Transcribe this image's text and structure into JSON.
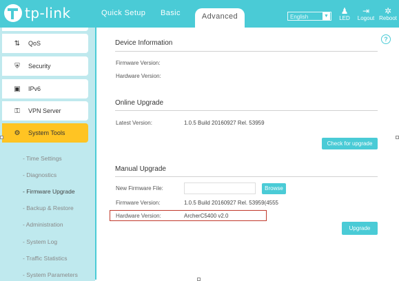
{
  "header": {
    "logo_text": "tp-link",
    "tabs": [
      {
        "label": "Quick Setup"
      },
      {
        "label": "Basic"
      },
      {
        "label": "Advanced"
      }
    ],
    "language": "English",
    "buttons": {
      "led": "LED",
      "logout": "Logout",
      "reboot": "Reboot"
    }
  },
  "sidebar": {
    "items": [
      {
        "label": "QoS",
        "icon": "arrows-updown-icon"
      },
      {
        "label": "Security",
        "icon": "shield-icon"
      },
      {
        "label": "IPv6",
        "icon": "ipv6-icon"
      },
      {
        "label": "VPN Server",
        "icon": "key-icon"
      },
      {
        "label": "System Tools",
        "icon": "gear-icon",
        "active": true
      }
    ],
    "subitems": [
      {
        "label": "- Time Settings"
      },
      {
        "label": "- Diagnostics"
      },
      {
        "label": "- Firmware Upgrade",
        "current": true
      },
      {
        "label": "- Backup & Restore"
      },
      {
        "label": "- Administration"
      },
      {
        "label": "- System Log"
      },
      {
        "label": "- Traffic Statistics"
      },
      {
        "label": "- System Parameters"
      }
    ]
  },
  "device_info": {
    "title": "Device Information",
    "firmware_label": "Firmware Version:",
    "hardware_label": "Hardware Version:"
  },
  "online_upgrade": {
    "title": "Online Upgrade",
    "latest_label": "Latest Version:",
    "latest_value": "1.0.5 Build 20160927 Rel. 53959",
    "check_button": "Check for upgrade"
  },
  "manual_upgrade": {
    "title": "Manual Upgrade",
    "new_file_label": "New Firmware File:",
    "file_value": "",
    "browse_button": "Browse",
    "firmware_label": "Firmware Version:",
    "firmware_value": "1.0.5 Build 20160927 Rel. 53959(4555",
    "hardware_label": "Hardware Version:",
    "hardware_value": "ArcherC5400 v2.0",
    "upgrade_button": "Upgrade"
  },
  "colors": {
    "accent": "#4acbd6",
    "active": "#ffc423",
    "highlight": "#c0392b"
  }
}
